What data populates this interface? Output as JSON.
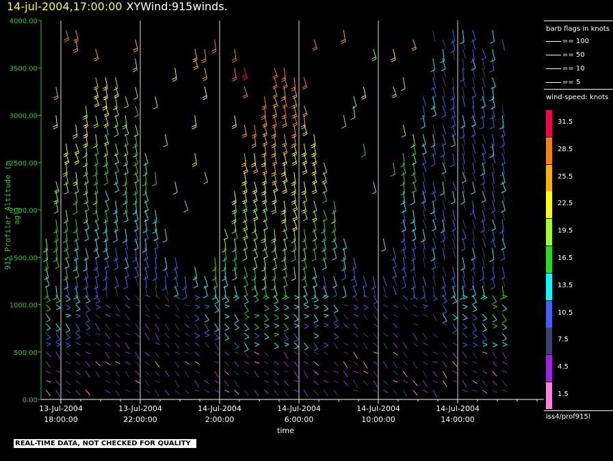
{
  "header": {
    "timestamp": "14-jul-2004,17:00:00",
    "name": "XYWind:915winds."
  },
  "axis": {
    "y_label": "915 Profiler Altitude (m agl)",
    "x_label": "time",
    "y_ticks": [
      "4000.00",
      "3500.00",
      "3000.00",
      "2500.00",
      "2000.00",
      "1500.00",
      "1000.00",
      "500.00",
      "0.00"
    ],
    "x_ticks": [
      {
        "date": "13-Jul-2004",
        "time": "18:00:00"
      },
      {
        "date": "13-Jul-2004",
        "time": "22:00:00"
      },
      {
        "date": "14-Jul-2004",
        "time": "2:00:00"
      },
      {
        "date": "14-Jul-2004",
        "time": "6:00:00"
      },
      {
        "date": "14-Jul-2004",
        "time": "10:00:00"
      },
      {
        "date": "14-Jul-2004",
        "time": "14:00:00"
      }
    ]
  },
  "legend": {
    "barb_title": "barb flags in knots",
    "barb_items": [
      "== 100",
      "== 50",
      "== 10",
      "== 5"
    ],
    "speed_title": "wind-speed: knots",
    "speed_levels": [
      {
        "label": "31.5",
        "color": "#ff0040"
      },
      {
        "label": "28.5",
        "color": "#ff8000"
      },
      {
        "label": "25.5",
        "color": "#ffb000"
      },
      {
        "label": "22.5",
        "color": "#ffff00"
      },
      {
        "label": "19.5",
        "color": "#a0ff20"
      },
      {
        "label": "16.5",
        "color": "#20e020"
      },
      {
        "label": "13.5",
        "color": "#00ffff"
      },
      {
        "label": "10.5",
        "color": "#4060ff"
      },
      {
        "label": "7.5",
        "color": "#404070"
      },
      {
        "label": "4.5",
        "color": "#a020f0"
      },
      {
        "label": "1.5",
        "color": "#ff80e0"
      }
    ],
    "source": "iss4/prof915l"
  },
  "note": "REAL-TIME DATA, NOT CHECKED FOR QUALITY",
  "chart_data": {
    "type": "scatter",
    "title": "XYWind:915winds.",
    "xlabel": "time",
    "ylabel": "915 Profiler Altitude (m agl)",
    "ylim": [
      0,
      4000
    ],
    "xlim_hours": [
      16.75,
      40.25
    ],
    "series": [
      {
        "name": "wind barbs",
        "description_units": "knots",
        "x_hours_from_13jul_00": "16.75..40.25 step ~0.5",
        "values": []
      }
    ]
  }
}
